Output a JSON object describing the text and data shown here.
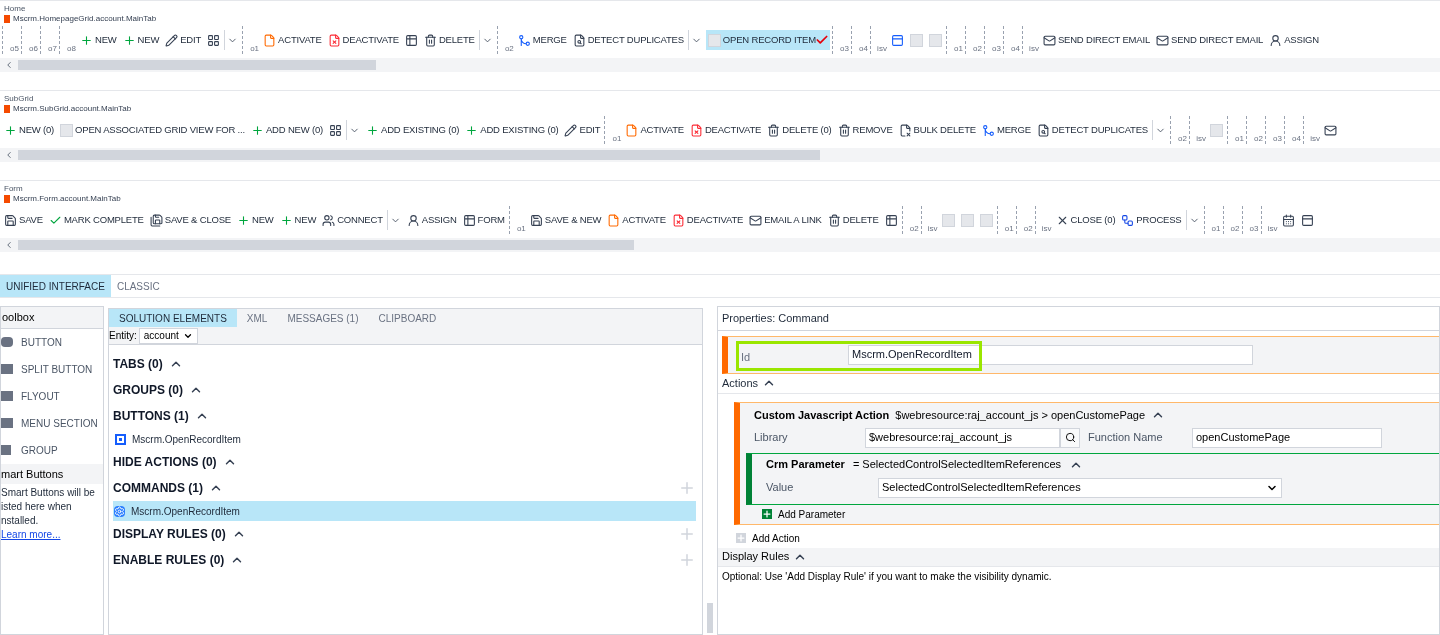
{
  "ribbons": [
    {
      "label": "Home",
      "tab_id": "Mscrm.HomepageGrid.account.MainTab",
      "items": [
        {
          "kind": "slot",
          "label": "o5"
        },
        {
          "kind": "slot",
          "label": "o6"
        },
        {
          "kind": "slot",
          "label": "o7"
        },
        {
          "kind": "slot",
          "label": "o8"
        },
        {
          "kind": "add",
          "label": "NEW",
          "selected": false
        },
        {
          "kind": "add",
          "label": "NEW",
          "selected": false
        },
        {
          "kind": "edit",
          "label": "EDIT",
          "selected": false
        },
        {
          "kind": "grid",
          "selected": false
        },
        {
          "kind": "dropdown"
        },
        {
          "kind": "slot",
          "label": "o1"
        },
        {
          "kind": "activate",
          "label": "ACTIVATE",
          "selected": false
        },
        {
          "kind": "deactivate",
          "label": "DEACTIVATE",
          "selected": false
        },
        {
          "kind": "form",
          "selected": false
        },
        {
          "kind": "delete",
          "label": "DELETE",
          "selected": false
        },
        {
          "kind": "dropdown"
        },
        {
          "kind": "slot",
          "label": "o2"
        },
        {
          "kind": "merge",
          "label": "MERGE",
          "selected": false
        },
        {
          "kind": "detect",
          "label": "DETECT DUPLICATES",
          "selected": false
        },
        {
          "kind": "dropdown"
        },
        {
          "kind": "open",
          "label": "OPEN RECORD ITEM",
          "selected": true
        },
        {
          "kind": "slot",
          "label": "o3"
        },
        {
          "kind": "slot",
          "label": "o4"
        },
        {
          "kind": "slot",
          "label": "isv"
        },
        {
          "kind": "tool",
          "selected": false
        },
        {
          "kind": "blank",
          "selected": false
        },
        {
          "kind": "blank",
          "selected": false
        },
        {
          "kind": "slot",
          "label": "o1"
        },
        {
          "kind": "slot",
          "label": "o2"
        },
        {
          "kind": "slot",
          "label": "o3"
        },
        {
          "kind": "slot",
          "label": "o4"
        },
        {
          "kind": "slot",
          "label": "isv"
        },
        {
          "kind": "email",
          "label": "SEND DIRECT EMAIL",
          "selected": false
        },
        {
          "kind": "email",
          "label": "SEND DIRECT EMAIL",
          "selected": false
        },
        {
          "kind": "assign",
          "label": "ASSIGN",
          "selected": false
        }
      ]
    },
    {
      "label": "SubGrid",
      "tab_id": "Mscrm.SubGrid.account.MainTab",
      "items": [
        {
          "kind": "add",
          "label": "NEW (0)"
        },
        {
          "kind": "view",
          "label": "OPEN ASSOCIATED GRID VIEW FOR ..."
        },
        {
          "kind": "add",
          "label": "ADD NEW (0)"
        },
        {
          "kind": "grid"
        },
        {
          "kind": "dropdown"
        },
        {
          "kind": "add",
          "label": "ADD EXISTING (0)"
        },
        {
          "kind": "add",
          "label": "ADD EXISTING (0)"
        },
        {
          "kind": "edit",
          "label": "EDIT"
        },
        {
          "kind": "slot",
          "label": "o1"
        },
        {
          "kind": "activate",
          "label": "ACTIVATE"
        },
        {
          "kind": "deactivate",
          "label": "DEACTIVATE"
        },
        {
          "kind": "delete",
          "label": "DELETE (0)"
        },
        {
          "kind": "delete",
          "label": "REMOVE"
        },
        {
          "kind": "bulkdelete",
          "label": "BULK DELETE"
        },
        {
          "kind": "merge",
          "label": "MERGE"
        },
        {
          "kind": "detect",
          "label": "DETECT DUPLICATES"
        },
        {
          "kind": "dropdown"
        },
        {
          "kind": "slot",
          "label": "o2"
        },
        {
          "kind": "slot",
          "label": "isv"
        },
        {
          "kind": "blank"
        },
        {
          "kind": "slot",
          "label": "o1"
        },
        {
          "kind": "slot",
          "label": "o2"
        },
        {
          "kind": "slot",
          "label": "o3"
        },
        {
          "kind": "slot",
          "label": "o4"
        },
        {
          "kind": "slot",
          "label": "isv"
        },
        {
          "kind": "email"
        }
      ]
    },
    {
      "label": "Form",
      "tab_id": "Mscrm.Form.account.MainTab",
      "items": [
        {
          "kind": "save",
          "label": "SAVE"
        },
        {
          "kind": "complete",
          "label": "MARK COMPLETE"
        },
        {
          "kind": "saveclose",
          "label": "SAVE & CLOSE"
        },
        {
          "kind": "add",
          "label": "NEW"
        },
        {
          "kind": "add",
          "label": "NEW"
        },
        {
          "kind": "connect",
          "label": "CONNECT"
        },
        {
          "kind": "dropdown"
        },
        {
          "kind": "assign",
          "label": "ASSIGN"
        },
        {
          "kind": "form",
          "label": "FORM"
        },
        {
          "kind": "slot",
          "label": "o1"
        },
        {
          "kind": "save",
          "label": "SAVE & NEW"
        },
        {
          "kind": "activate",
          "label": "ACTIVATE"
        },
        {
          "kind": "deactivate",
          "label": "DEACTIVATE"
        },
        {
          "kind": "email",
          "label": "EMAIL A LINK"
        },
        {
          "kind": "delete",
          "label": "DELETE"
        },
        {
          "kind": "form"
        },
        {
          "kind": "slot",
          "label": "o2"
        },
        {
          "kind": "slot",
          "label": "isv"
        },
        {
          "kind": "blank"
        },
        {
          "kind": "blank"
        },
        {
          "kind": "blank"
        },
        {
          "kind": "slot",
          "label": "o1"
        },
        {
          "kind": "slot",
          "label": "o2"
        },
        {
          "kind": "slot",
          "label": "isv"
        },
        {
          "kind": "close",
          "label": "CLOSE (0)"
        },
        {
          "kind": "process",
          "label": "PROCESS"
        },
        {
          "kind": "dropdown"
        },
        {
          "kind": "slot",
          "label": "o1"
        },
        {
          "kind": "slot",
          "label": "o2"
        },
        {
          "kind": "slot",
          "label": "o3"
        },
        {
          "kind": "slot",
          "label": "isv"
        },
        {
          "kind": "calendar"
        },
        {
          "kind": "panel"
        }
      ]
    }
  ],
  "mode_tabs": [
    {
      "label": "UNIFIED INTERFACE",
      "selected": true
    },
    {
      "label": "CLASSIC",
      "selected": false
    }
  ],
  "toolbox": {
    "title": "oolbox",
    "items": [
      {
        "kind": "button",
        "label": "BUTTON"
      },
      {
        "kind": "split",
        "label": "SPLIT BUTTON"
      },
      {
        "kind": "flyout",
        "label": "FLYOUT"
      },
      {
        "kind": "menu",
        "label": "MENU SECTION"
      },
      {
        "kind": "group",
        "label": "GROUP"
      }
    ],
    "smart_title": "mart Buttons",
    "smart_text": "Smart Buttons will be isted here when nstalled.",
    "link": "Learn more..."
  },
  "solution": {
    "tabs": [
      {
        "label": "SOLUTION ELEMENTS",
        "selected": true
      },
      {
        "label": "XML",
        "selected": false
      },
      {
        "label": "MESSAGES (1)",
        "selected": false
      },
      {
        "label": "CLIPBOARD",
        "selected": false
      }
    ],
    "entity_label": "Entity:",
    "entity_value": "account",
    "sections": [
      {
        "title": "TABS (0)",
        "expanded": true,
        "addable": false
      },
      {
        "title": "GROUPS (0)",
        "expanded": true,
        "addable": false
      },
      {
        "title": "BUTTONS (1)",
        "expanded": true,
        "addable": false,
        "children": [
          {
            "kind": "button",
            "label": "Mscrm.OpenRecordItem",
            "selected": false
          }
        ]
      },
      {
        "title": "HIDE ACTIONS (0)",
        "expanded": true,
        "addable": false
      },
      {
        "title": "COMMANDS (1)",
        "expanded": true,
        "addable": true,
        "children": [
          {
            "kind": "command",
            "label": "Mscrm.OpenRecordItem",
            "selected": true
          }
        ]
      },
      {
        "title": "DISPLAY RULES (0)",
        "expanded": true,
        "addable": true
      },
      {
        "title": "ENABLE RULES (0)",
        "expanded": true,
        "addable": true
      }
    ]
  },
  "properties": {
    "title": "Properties: Command",
    "id_label": "Id",
    "id_value": "Mscrm.OpenRecordItem",
    "id_highlighted": true,
    "actions_title": "Actions",
    "actions_expanded": true,
    "action": {
      "title": "Custom Javascript Action",
      "summary": "$webresource:raj_account_js > openCustomePage",
      "expanded": true,
      "library_label": "Library",
      "library_value": "$webresource:raj_account_js",
      "function_label": "Function Name",
      "function_value": "openCustomePage",
      "parameter": {
        "title": "Crm Parameter",
        "summary": "= SelectedControlSelectedItemReferences",
        "expanded": true,
        "value_label": "Value",
        "value": "SelectedControlSelectedItemReferences"
      },
      "add_parameter": "Add Parameter"
    },
    "add_action": "Add Action",
    "display_rules_title": "Display Rules",
    "display_rules_expanded": true,
    "display_rules_hint": "Optional: Use 'Add Display Rule' if you want to make the visibility dynamic."
  }
}
